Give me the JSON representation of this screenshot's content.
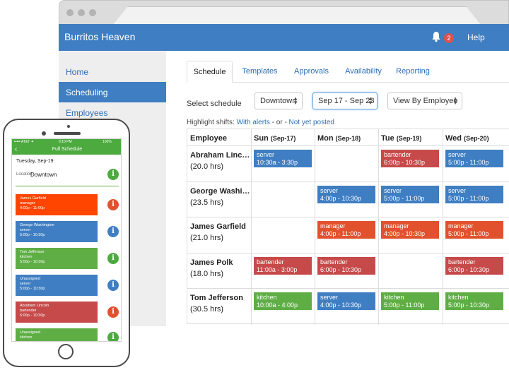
{
  "app": {
    "title": "Burritos Heaven",
    "notification_count": "2",
    "help_label": "Help"
  },
  "sidebar": {
    "items": [
      {
        "label": "Home"
      },
      {
        "label": "Scheduling",
        "active": true
      },
      {
        "label": "Employees"
      }
    ]
  },
  "tabs": [
    {
      "label": "Schedule",
      "active": true
    },
    {
      "label": "Templates"
    },
    {
      "label": "Approvals"
    },
    {
      "label": "Availability"
    },
    {
      "label": "Reporting"
    }
  ],
  "filters": {
    "select_label": "Select schedule",
    "location": "Downtown",
    "date_range": "Sep 17 - Sep 23",
    "view": "View By Employee"
  },
  "highlight": {
    "prefix": "Highlight shifts:",
    "alerts_link": "With alerts",
    "separator": "- or -",
    "unposted_link": "Not yet posted"
  },
  "grid": {
    "employee_header": "Employee",
    "days": [
      {
        "day": "Sun",
        "date": "(Sep-17)"
      },
      {
        "day": "Mon",
        "date": "(Sep-18)"
      },
      {
        "day": "Tue",
        "date": "(Sep-19)"
      },
      {
        "day": "Wed",
        "date": "(Sep-20)"
      }
    ],
    "employees": [
      {
        "name": "Abraham Linc…",
        "hours": "(20.0 hrs)"
      },
      {
        "name": "George Washi…",
        "hours": "(23.5 hrs)"
      },
      {
        "name": "James Garfield",
        "hours": "(21.0 hrs)"
      },
      {
        "name": "James Polk",
        "hours": "(18.0 hrs)"
      },
      {
        "name": "Tom Jefferson",
        "hours": "(30.5 hrs)"
      }
    ],
    "shifts": {
      "r0": {
        "sun": {
          "role": "server",
          "time": "10:30a - 3:30p"
        },
        "tue": {
          "role": "bartender",
          "time": "6:00p - 10:30p"
        },
        "wed": {
          "role": "server",
          "time": "5:00p - 11:00p"
        }
      },
      "r1": {
        "mon": {
          "role": "server",
          "time": "4:00p - 10:30p"
        },
        "tue": {
          "role": "server",
          "time": "5:00p - 11:00p"
        },
        "wed": {
          "role": "server",
          "time": "5:00p - 11:00p"
        }
      },
      "r2": {
        "mon": {
          "role": "manager",
          "time": "4:00p - 11:00p"
        },
        "tue": {
          "role": "manager",
          "time": "4:00p - 10:30p"
        },
        "wed": {
          "role": "manager",
          "time": "5:00p - 11:00p"
        }
      },
      "r3": {
        "sun": {
          "role": "bartender",
          "time": "11:00a - 3:00p"
        },
        "mon": {
          "role": "bartender",
          "time": "6:00p - 10:30p"
        },
        "wed": {
          "role": "bartender",
          "time": "6:00p - 10:30p"
        }
      },
      "r4": {
        "sun": {
          "role": "kitchen",
          "time": "10:00a - 4:00p"
        },
        "mon": {
          "role": "server",
          "time": "4:00p - 10:30p"
        },
        "tue": {
          "role": "kitchen",
          "time": "5:00p - 11:00p"
        },
        "wed": {
          "role": "kitchen",
          "time": "5:00p - 10:30p"
        }
      }
    }
  },
  "phone": {
    "status_left": "••••• AT&T ✦",
    "status_time": "9:10 PM",
    "status_right": "100%",
    "title": "Full Schedule",
    "date": "Tuesday, Sep-19",
    "location_label": "Location",
    "location": "Downtown",
    "cards": [
      {
        "name": "James Garfield",
        "role": "manager",
        "time": "4:00p - 11:00p"
      },
      {
        "name": "George Washington",
        "role": "server",
        "time": "5:00p - 10:30p"
      },
      {
        "name": "Tom Jefferson",
        "role": "kitchen",
        "time": "5:00p - 10:30p"
      },
      {
        "name": "Unassigned",
        "role": "server",
        "time": "5:00p - 10:30p"
      },
      {
        "name": "Abraham Lincoln",
        "role": "bartender",
        "time": "6:00p - 10:30p"
      },
      {
        "name": "Unassigned",
        "role": "kitchen",
        "time": ""
      }
    ]
  },
  "colors": {
    "header_blue": "#3f7ec2",
    "server": "#3f7ec2",
    "bartender": "#c64a4a",
    "manager": "#e2512d",
    "kitchen": "#5fae45",
    "phone_green": "#4caa3f"
  }
}
